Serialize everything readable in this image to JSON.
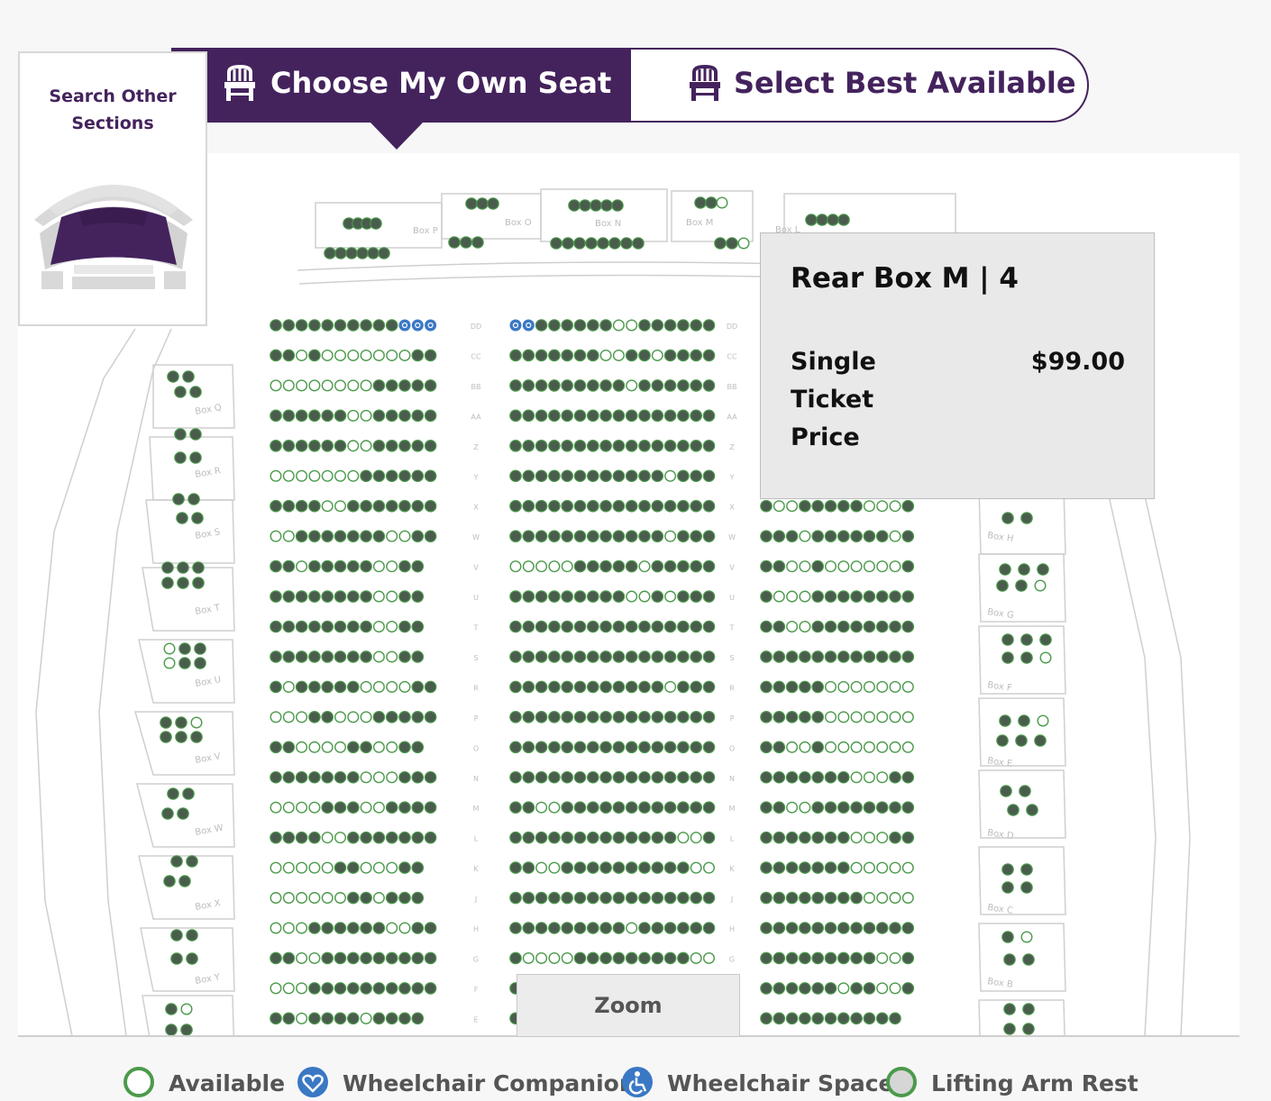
{
  "tabs": {
    "own_label": "Choose My Own Seat",
    "best_label": "Select Best Available",
    "active": "own"
  },
  "search_panel": {
    "title": "Search Other Sections"
  },
  "tooltip": {
    "title": "Rear Box M | 4",
    "label": "Single Ticket Price",
    "price": "$99.00"
  },
  "zoom": {
    "label": "Zoom"
  },
  "legend": [
    {
      "label": "Available",
      "icon": "available-circle-icon"
    },
    {
      "label": "Wheelchair Companion",
      "icon": "heart-icon"
    },
    {
      "label": "Wheelchair Space",
      "icon": "wheelchair-icon"
    },
    {
      "label": "Lifting Arm Rest",
      "icon": "lifting-arm-rest-icon"
    }
  ],
  "row_labels": [
    "DD",
    "CC",
    "BB",
    "AA",
    "Z",
    "Y",
    "X",
    "W",
    "V",
    "U",
    "T",
    "S",
    "R",
    "P",
    "O",
    "N",
    "M",
    "L",
    "K",
    "J",
    "H",
    "G",
    "F",
    "E"
  ],
  "box_labels_left": [
    "Box Q",
    "Box R",
    "Box S",
    "Box T",
    "Box U",
    "Box V",
    "Box W",
    "Box X",
    "Box Y"
  ],
  "box_labels_right": [
    "Box H",
    "Box G",
    "Box F",
    "Box E",
    "Box D",
    "Box C",
    "Box B"
  ],
  "box_labels_top": [
    "Box P",
    "Box O",
    "Box N",
    "Box M",
    "Box L"
  ],
  "seat_rows_left": [
    "SSSSSSSSSSccc",
    "SSASAAAAAAASS",
    "AAAAAAAASSSSS",
    "SSSSSSAASSSSS",
    "SSSSSSAASSSSS",
    "AAAAAAASSSSSS",
    "SSSSAASSSSSSS",
    "AASSSSSSSAASS",
    "SSASSSSSAASS",
    "SSSSSSSSAASS",
    "SSSSSSSSAASS",
    "SSSSSSSSAASS",
    "SASSSSSAAAASS",
    "AAASSAAASSSSS",
    "SSAAAASSAASS",
    "SSSSSSSAAASSS",
    "AAAASSSAASSSS",
    "SSSSAASSSSSSS",
    "AAAAASSAAASS",
    "AAAAAASSASSS",
    "AAASSSSSSAASS",
    "SSAASSSSSSSSS",
    "AAASSSSSSSSSS",
    "SSASSSSASSSS"
  ],
  "seat_rows_center": [
    "ccSSSSSSAASSSSSS",
    "SSSSSSSAASSASSSS",
    "SSSSSSSSSASSSSSS",
    "SSSSSSSSSSSSSSSS",
    "SSSSSSSSSSSSSSSS",
    "SSSSSSSSSSSSASSS",
    "SSSSSSSSSSSSSSSS",
    "SSSSSSSSSSSSASSS",
    "AAAAASSSSSASSSSS",
    "SSSSSSSSSAASASSS",
    "SSSSSSSSSSSSSSSS",
    "SSSSSSSSSSSSSSSS",
    "SSSSSSSSSSSSASSS",
    "SSSSSSSSSSSSSSSS",
    "SSSSSSSSSSSSSSSS",
    "SSSSSSSSSSSSSSSS",
    "SSAASSSSSSSSSSSS",
    "SSSSSSSSSSSSSAAS",
    "SSAASSSSSSSSSSAA",
    "SSSSSSSSSSSSSSSS",
    "SSSSSSSSSASSSSSS",
    "SAAAASSSSSSSSSAA",
    "S",
    "S"
  ],
  "seat_rows_right": [
    "SSSSSSSSSSSSSS",
    "SSSSSSSSSSSSSS",
    "SSSSSSSSSSSSSS",
    "SSSSSSSSSSSSSS",
    "SSSSSSSSSSSSSS",
    "SSSSSSSSSSSSSS",
    "SAASSSSSAAAS",
    "SSSASSSSSSAS",
    "SSAASAAAAAAS",
    "SAAASSSSSSSS",
    "SSAASSSSSSSS",
    "SSSSSSSSSSSS",
    "SSSSSAAAAAAA",
    "SSSSSAAAAAAA",
    "SSAASAAAAAAA",
    "SSSSSSSAAASS",
    "SSAASSSSSSSS",
    "SSSSSSSAAASS",
    "SSSSSSSAAAAA",
    "SSSSSSSSAAAA",
    "SSSSSSSSSSSS",
    "SSSSSSSSSAAS",
    "SSSSSSASSAAS",
    "SSSSSSSSSSS"
  ],
  "colors": {
    "brand_purple": "#44235d",
    "sold_seat": "#4a5d4d",
    "available_outline": "#4c9a4c",
    "accessible_blue": "#3a78c4"
  }
}
